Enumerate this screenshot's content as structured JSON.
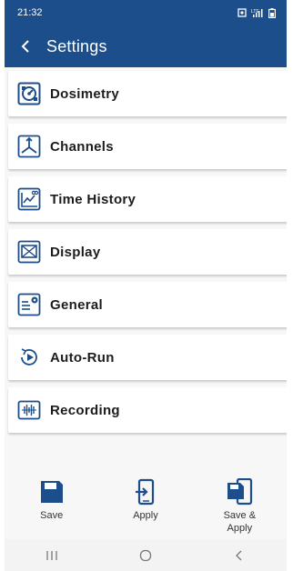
{
  "status": {
    "time": "21:32"
  },
  "header": {
    "title": "Settings"
  },
  "menu": [
    {
      "label": "Dosimetry",
      "icon": "dosimetry-icon"
    },
    {
      "label": "Channels",
      "icon": "channels-icon"
    },
    {
      "label": "Time History",
      "icon": "time-history-icon"
    },
    {
      "label": "Display",
      "icon": "display-icon"
    },
    {
      "label": "General",
      "icon": "general-icon"
    },
    {
      "label": "Auto-Run",
      "icon": "auto-run-icon"
    },
    {
      "label": "Recording",
      "icon": "recording-icon"
    }
  ],
  "actions": {
    "save": "Save",
    "apply": "Apply",
    "save_apply_line1": "Save &",
    "save_apply_line2": "Apply"
  },
  "colors": {
    "primary": "#1d4e8c",
    "icon": "#1d4e8c"
  }
}
